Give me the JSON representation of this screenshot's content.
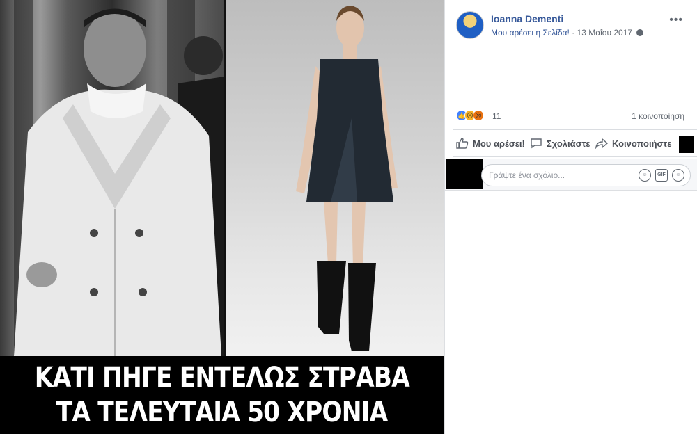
{
  "post": {
    "author": "Ioanna Dementi",
    "liked_page": "Μου αρέσει η Σελίδα!",
    "separator": "·",
    "date": "13 Μαΐου 2017",
    "more_icon": "more-options-icon"
  },
  "image": {
    "caption_line1": "ΚΑΤΙ ΠΗΓΕ ΕΝΤΕΛΩΣ ΣΤΡΑΒΑ",
    "caption_line2": "ΤΑ ΤΕΛΕΥΤΑΙΑ 50 ΧΡΟΝΙΑ"
  },
  "reactions": {
    "count": "11",
    "shares": "1 κοινοποίηση",
    "types": [
      "like",
      "sad",
      "angry"
    ]
  },
  "actions": {
    "like": "Μου αρέσει!",
    "comment": "Σχολιάστε",
    "share": "Κοινοποιήστε"
  },
  "comment": {
    "placeholder": "Γράψτε ένα σχόλιο..."
  },
  "colors": {
    "link": "#365899",
    "muted": "#606770",
    "like_blue": "#4080ff"
  }
}
